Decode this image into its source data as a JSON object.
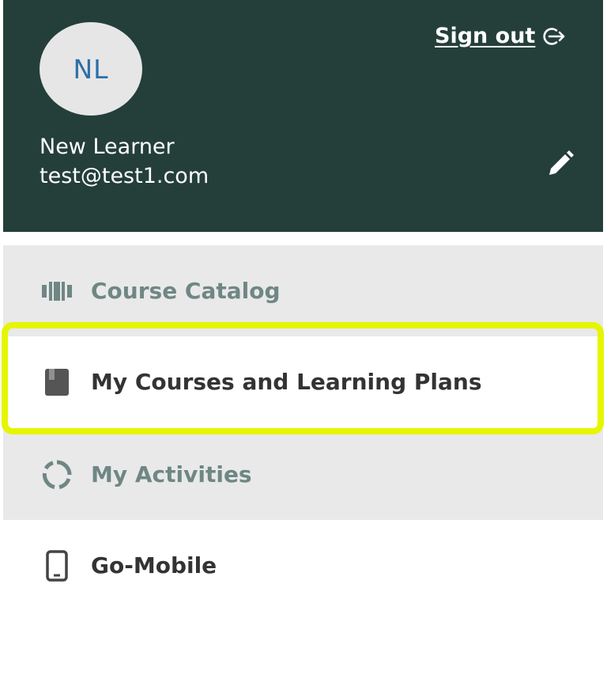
{
  "user": {
    "initials": "NL",
    "name": "New Learner",
    "email": "test@test1.com"
  },
  "header": {
    "sign_out_label": "Sign out",
    "background_color": "#243f3a"
  },
  "menu": {
    "items": [
      {
        "label": "Course Catalog",
        "icon": "catalog-icon",
        "state": "inactive"
      },
      {
        "label": "My Courses and Learning Plans",
        "icon": "book-icon",
        "state": "active-highlighted"
      },
      {
        "label": "My Activities",
        "icon": "activity-ring-icon",
        "state": "inactive"
      },
      {
        "label": "Go-Mobile",
        "icon": "mobile-phone-icon",
        "state": "active"
      }
    ]
  },
  "colors": {
    "highlight": "#e6f500",
    "inactive_text": "#6f8784",
    "active_text": "#333333",
    "inactive_background": "#e9e9e9"
  }
}
